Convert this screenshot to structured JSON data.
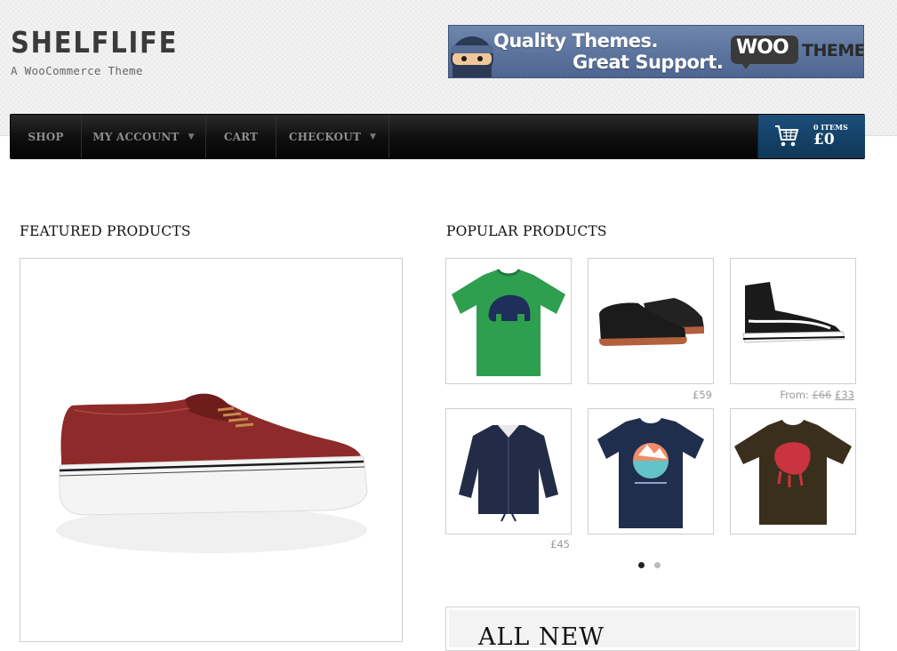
{
  "site": {
    "title": "SHELFLIFE",
    "tagline": "A WooCommerce Theme"
  },
  "banner": {
    "line1": "Quality Themes.",
    "line2": "Great Support.",
    "brand_woo": "WOO",
    "brand_themes": "THEMES"
  },
  "nav": {
    "items": [
      {
        "label": "SHOP"
      },
      {
        "label": "MY ACCOUNT",
        "dropdown": true
      },
      {
        "label": "CART"
      },
      {
        "label": "CHECKOUT",
        "dropdown": true
      }
    ],
    "cart": {
      "items_label": "0 ITEMS",
      "total": "£0",
      "icon": "cart-icon"
    }
  },
  "featured": {
    "heading": "FEATURED PRODUCTS",
    "product": {
      "image": "red-leather-sneaker"
    }
  },
  "popular": {
    "heading": "POPULAR PRODUCTS",
    "products": [
      {
        "image": "green-elephant-tshirt",
        "price": ""
      },
      {
        "image": "black-leather-boots",
        "price": "£59"
      },
      {
        "image": "black-hightop-sneakers",
        "price_prefix": "From: ",
        "price_old": "£66",
        "price_new": "£33"
      },
      {
        "image": "navy-coach-jacket",
        "price": "£45"
      },
      {
        "image": "navy-australia-tshirt",
        "price": ""
      },
      {
        "image": "brown-graphic-tshirt",
        "price": ""
      }
    ],
    "pagination": {
      "pages": 2,
      "active": 1
    }
  },
  "promo": {
    "text": "ALL NEW"
  },
  "colors": {
    "nav_bg": "#0e0e0e",
    "cart_bg": "#123f66",
    "banner_bg": "#5b72a0"
  }
}
